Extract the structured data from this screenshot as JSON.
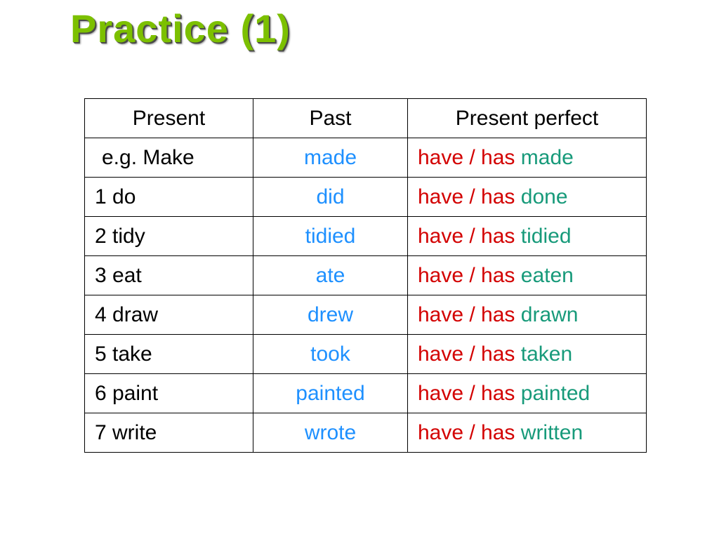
{
  "title": "Practice (1)",
  "headers": {
    "present": "Present",
    "past": "Past",
    "pp": "Present perfect"
  },
  "havehas": "have / has",
  "rows": [
    {
      "present": "e.g. Make",
      "past": "made",
      "pp_verb": "made",
      "example": true
    },
    {
      "present": "1  do",
      "past": "did",
      "pp_verb": "done",
      "example": false
    },
    {
      "present": "2  tidy",
      "past": "tidied",
      "pp_verb": "tidied",
      "example": false
    },
    {
      "present": "3  eat",
      "past": "ate",
      "pp_verb": "eaten",
      "example": false
    },
    {
      "present": "4  draw",
      "past": "drew",
      "pp_verb": "drawn",
      "example": false
    },
    {
      "present": "5  take",
      "past": "took",
      "pp_verb": "taken",
      "example": false
    },
    {
      "present": "6  paint",
      "past": "painted",
      "pp_verb": "painted",
      "example": false
    },
    {
      "present": "7  write",
      "past": "wrote",
      "pp_verb": "written",
      "example": false
    }
  ]
}
